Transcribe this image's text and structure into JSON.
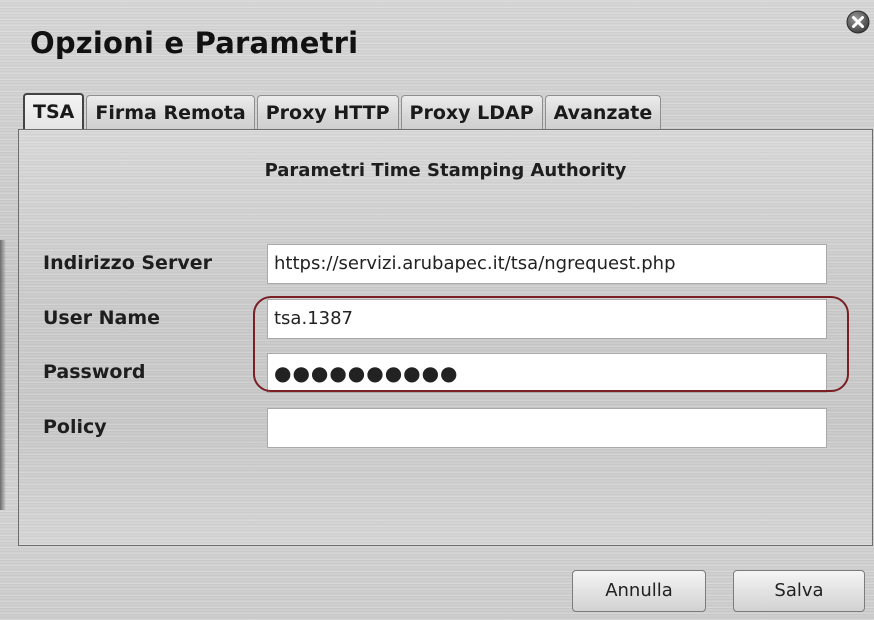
{
  "window": {
    "title": "Opzioni e Parametri"
  },
  "tabs": [
    {
      "label": "TSA",
      "active": true
    },
    {
      "label": "Firma Remota",
      "active": false
    },
    {
      "label": "Proxy HTTP",
      "active": false
    },
    {
      "label": "Proxy LDAP",
      "active": false
    },
    {
      "label": "Avanzate",
      "active": false
    }
  ],
  "tsa": {
    "section_title": "Parametri Time Stamping Authority",
    "fields": {
      "server": {
        "label": "Indirizzo Server",
        "value": "https://servizi.arubapec.it/tsa/ngrequest.php"
      },
      "username": {
        "label": "User Name",
        "value": "tsa.1387"
      },
      "password": {
        "label": "Password",
        "value": "●●●●●●●●●●"
      },
      "policy": {
        "label": "Policy",
        "value": ""
      }
    }
  },
  "buttons": {
    "cancel": "Annulla",
    "save": "Salva"
  },
  "icons": {
    "close": "close-icon"
  },
  "colors": {
    "highlight": "#7a1f24"
  }
}
